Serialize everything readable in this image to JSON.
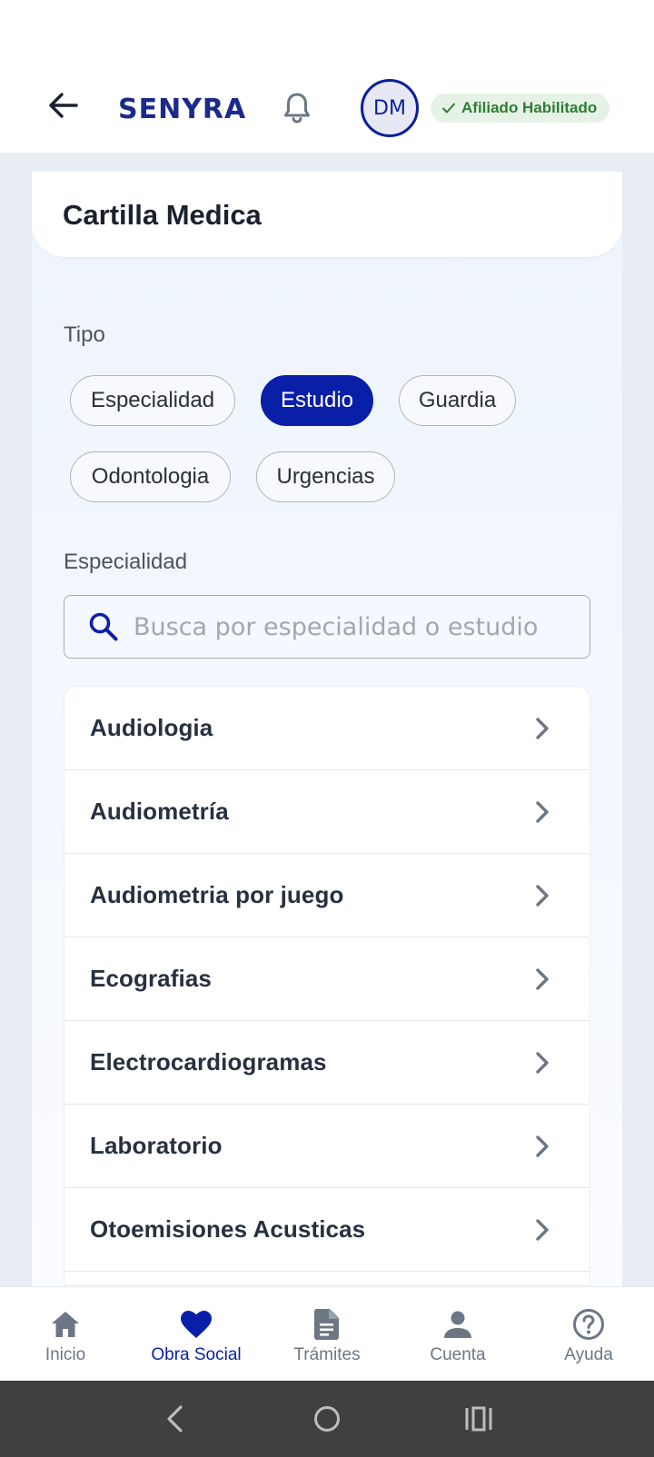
{
  "header": {
    "brand": "SENYRA",
    "avatar_initials": "DM",
    "status_badge": "Afiliado Habilitado",
    "icons": {
      "back": "arrow-left-icon",
      "bell": "bell-icon",
      "check": "check-icon"
    },
    "colors": {
      "brand": "#1a2a8c",
      "badge_bg": "#e6f2e6",
      "badge_text": "#2e7d32"
    }
  },
  "page": {
    "title": "Cartilla Medica"
  },
  "tipo": {
    "label": "Tipo",
    "selected": "Estudio",
    "chips": [
      {
        "label": "Especialidad"
      },
      {
        "label": "Estudio"
      },
      {
        "label": "Guardia"
      },
      {
        "label": "Odontologia"
      },
      {
        "label": "Urgencias"
      }
    ]
  },
  "especialidad": {
    "label": "Especialidad",
    "search": {
      "placeholder": "Busca por especialidad o estudio",
      "value": ""
    }
  },
  "results": [
    {
      "label": "Audiologia"
    },
    {
      "label": "Audiometría"
    },
    {
      "label": "Audiometria por juego"
    },
    {
      "label": "Ecografias"
    },
    {
      "label": "Electrocardiogramas"
    },
    {
      "label": "Laboratorio"
    },
    {
      "label": "Otoemisiones Acusticas"
    },
    {
      "label": ""
    }
  ],
  "bottom_nav": {
    "active": "Obra Social",
    "items": [
      {
        "label": "Inicio",
        "icon": "home-icon"
      },
      {
        "label": "Obra Social",
        "icon": "heart-icon"
      },
      {
        "label": "Trámites",
        "icon": "document-icon"
      },
      {
        "label": "Cuenta",
        "icon": "person-icon"
      },
      {
        "label": "Ayuda",
        "icon": "help-icon"
      }
    ]
  },
  "colors": {
    "primary": "#0a1fa8",
    "chip_selected_bg": "#0a1fa8",
    "muted": "#6d7684"
  }
}
